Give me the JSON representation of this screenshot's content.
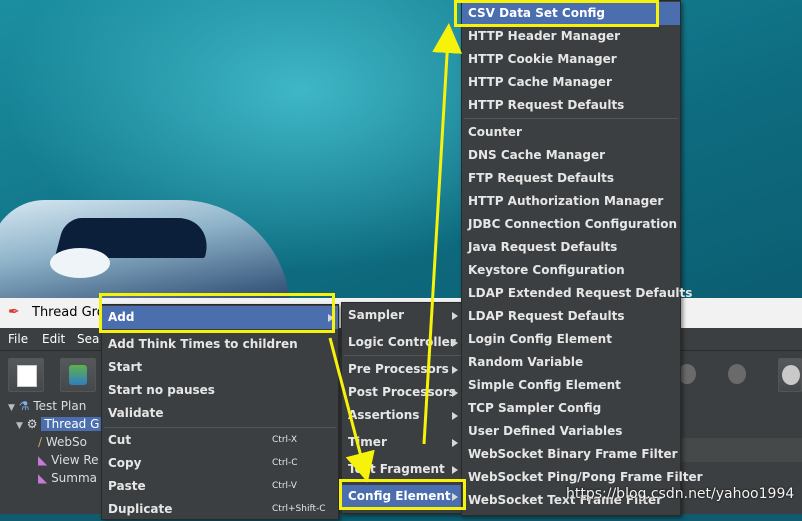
{
  "window": {
    "title": "Thread Gro"
  },
  "menubar": {
    "items": [
      "File",
      "Edit",
      "Sea"
    ]
  },
  "tree": {
    "items": [
      {
        "label": "Test Plan"
      },
      {
        "label": "Thread G"
      },
      {
        "label": "WebSo"
      },
      {
        "label": "View Re"
      },
      {
        "label": "Summa"
      }
    ]
  },
  "context_menu": {
    "items": [
      {
        "label": "Add"
      },
      {
        "label": "Add Think Times to children"
      },
      {
        "label": "Start"
      },
      {
        "label": "Start no pauses"
      },
      {
        "label": "Validate"
      },
      {
        "label": "Cut",
        "shortcut": "Ctrl-X"
      },
      {
        "label": "Copy",
        "shortcut": "Ctrl-C"
      },
      {
        "label": "Paste",
        "shortcut": "Ctrl-V"
      },
      {
        "label": "Duplicate",
        "shortcut": "Ctrl+Shift-C"
      }
    ]
  },
  "add_submenu": {
    "items": [
      {
        "label": "Sampler"
      },
      {
        "label": "Logic Controller"
      },
      {
        "label": "Pre Processors"
      },
      {
        "label": "Post Processors"
      },
      {
        "label": "Assertions"
      },
      {
        "label": "Timer"
      },
      {
        "label": "Test Fragment"
      },
      {
        "label": "Config Element"
      }
    ]
  },
  "config_submenu": {
    "items": [
      {
        "label": "CSV Data Set Config"
      },
      {
        "label": "HTTP Header Manager"
      },
      {
        "label": "HTTP Cookie Manager"
      },
      {
        "label": "HTTP Cache Manager"
      },
      {
        "label": "HTTP Request Defaults"
      },
      {
        "label": "Counter"
      },
      {
        "label": "DNS Cache Manager"
      },
      {
        "label": "FTP Request Defaults"
      },
      {
        "label": "HTTP Authorization Manager"
      },
      {
        "label": "JDBC Connection Configuration"
      },
      {
        "label": "Java Request Defaults"
      },
      {
        "label": "Keystore Configuration"
      },
      {
        "label": "LDAP Extended Request Defaults"
      },
      {
        "label": "LDAP Request Defaults"
      },
      {
        "label": "Login Config Element"
      },
      {
        "label": "Random Variable"
      },
      {
        "label": "Simple Config Element"
      },
      {
        "label": "TCP Sampler Config"
      },
      {
        "label": "User Defined Variables"
      },
      {
        "label": "WebSocket Binary Frame Filter"
      },
      {
        "label": "WebSocket Ping/Pong Frame Filter"
      },
      {
        "label": "WebSocket Text Frame Filter"
      }
    ]
  },
  "watermark": "https://blog.csdn.net/yahoo1994",
  "colors": {
    "selection": "#4b6eaf",
    "highlight_box": "#f6f20a",
    "menu_bg": "#3c3f41"
  }
}
